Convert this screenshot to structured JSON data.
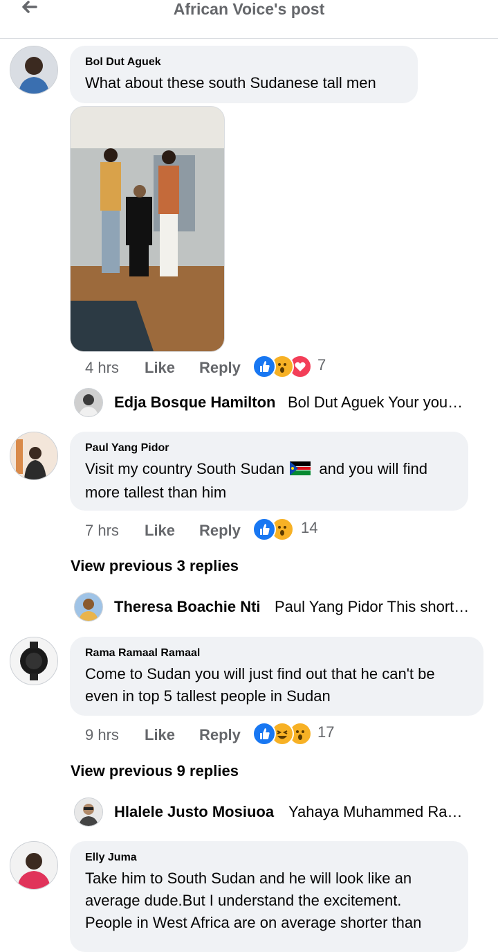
{
  "header": {
    "title": "African Voice's post",
    "back_icon": "arrow-left-icon"
  },
  "comments": [
    {
      "name": "Bol Dut Aguek",
      "text": "What about these south Sudanese tall men",
      "time": "4 hrs",
      "like": "Like",
      "reply": "Reply",
      "reaction_count": "7",
      "reactions": [
        "like",
        "wow",
        "love"
      ]
    },
    {
      "name": "Paul Yang Pidor",
      "text_before_flag": "Visit my country South Sudan ",
      "text_after_flag": " and you will find more tallest than him",
      "time": "7 hrs",
      "like": "Like",
      "reply": "Reply",
      "reaction_count": "14",
      "reactions": [
        "like",
        "wow"
      ]
    },
    {
      "name": "Rama Ramaal Ramaal",
      "text": "Come to Sudan you will just find out that he can't be even in top 5 tallest people in Sudan",
      "time": "9 hrs",
      "like": "Like",
      "reply": "Reply",
      "reaction_count": "17",
      "reactions": [
        "like",
        "haha",
        "wow"
      ]
    },
    {
      "name": "Elly Juma",
      "text": "Take him to South Sudan and he will look like an average dude.But I understand the excitement. People in West Africa are on average shorter than"
    }
  ],
  "replies": [
    {
      "name": "Edja Bosque Hamilton",
      "text": "Bol Dut Aguek Your young brother..."
    },
    {
      "name": "Theresa Boachie Nti",
      "text": "Paul Yang Pidor This short man..."
    },
    {
      "name": "Hlalele Justo Mosiuoa",
      "text": "Yahaya Muhammed Ramadhan..."
    }
  ],
  "view_previous": [
    "View previous 3 replies",
    "View previous 9 replies"
  ],
  "colors": {
    "like": "#1877f2",
    "wow": "#f7b125",
    "love": "#f33e58",
    "muted": "#65676b",
    "bubble": "#f0f2f5"
  }
}
